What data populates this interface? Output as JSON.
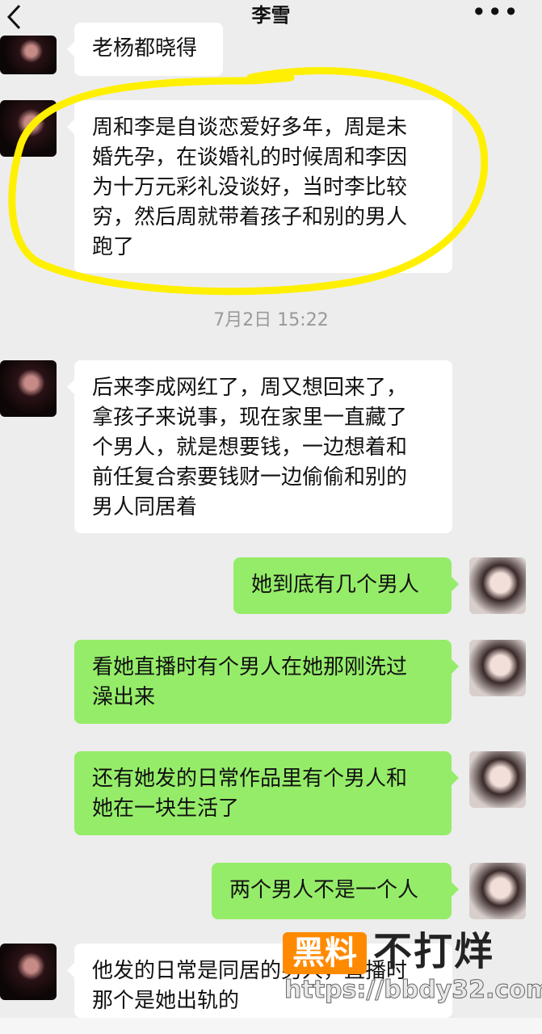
{
  "header": {
    "back_icon": "chevron-left-icon",
    "title": "李雪",
    "more_icon": "more-icon",
    "more_glyph": "•••"
  },
  "messages": [
    {
      "side": "left",
      "text": "老杨都晓得"
    },
    {
      "side": "left",
      "text": "周和李是自谈恋爱好多年，周是未\n婚先孕，在谈婚礼的时候周和李因\n为十万元彩礼没谈好，当时李比较\n穷，然后周就带着孩子和别的男人\n跑了"
    },
    {
      "side": "left",
      "text": "后来李成网红了，周又想回来了，\n拿孩子来说事，现在家里一直藏了\n个男人，就是想要钱，一边想着和\n前任复合索要钱财一边偷偷和别的\n男人同居着"
    },
    {
      "side": "right",
      "text": "她到底有几个男人"
    },
    {
      "side": "right",
      "text": "看她直播时有个男人在她那刚洗过\n澡出来"
    },
    {
      "side": "right",
      "text": "还有她发的日常作品里有个男人和\n她在一块生活了"
    },
    {
      "side": "right",
      "text": "两个男人不是一个人"
    },
    {
      "side": "left",
      "text": "他发的日常是同居的男人，直播时\n那个是她出轨的"
    }
  ],
  "timestamp": "7月2日 15:22",
  "watermark": {
    "logo": "黑料",
    "brand": "不打烊",
    "url": "https://bbdy32.com"
  },
  "colors": {
    "background": "#ededed",
    "bubble_left": "#ffffff",
    "bubble_right": "#95ec69",
    "highlight": "#ffef00"
  }
}
